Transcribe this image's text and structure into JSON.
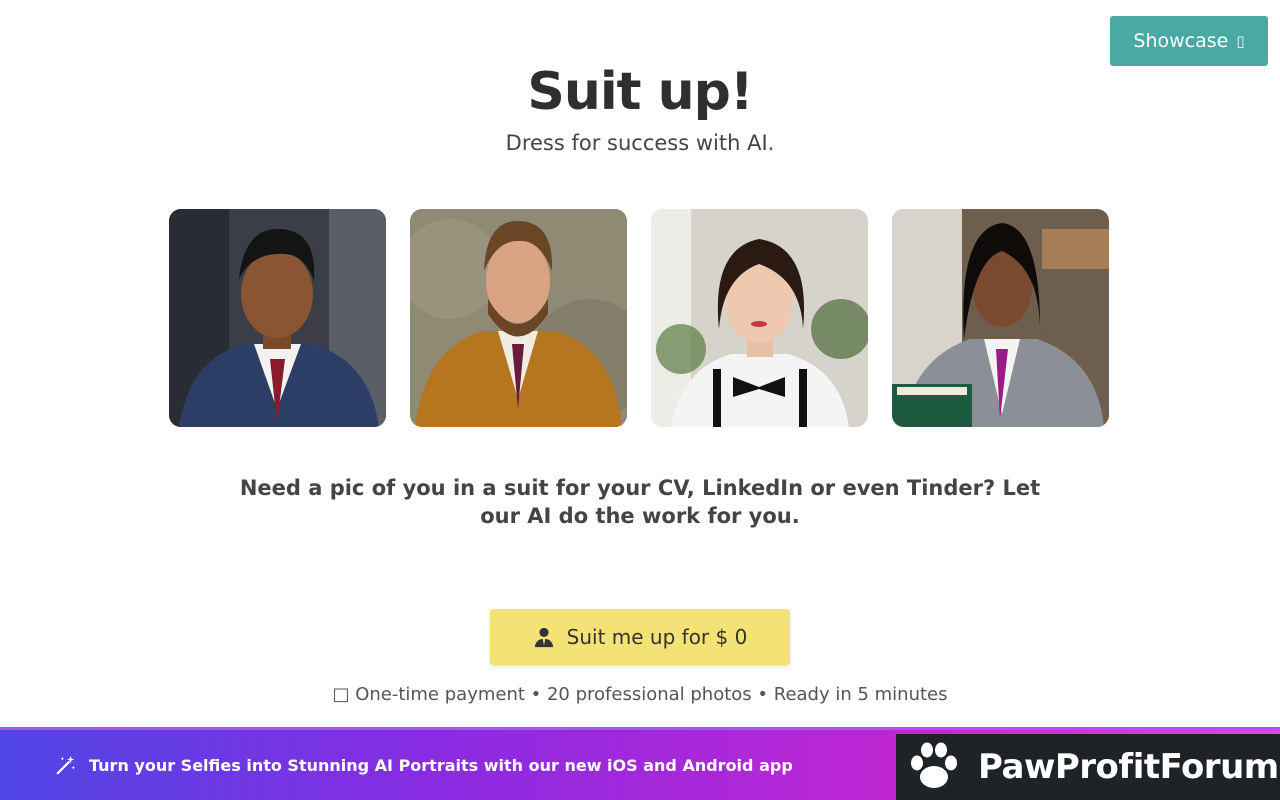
{
  "header": {
    "showcase_label": "Showcase",
    "showcase_icon": "external-link-icon"
  },
  "hero": {
    "title": "Suit up!",
    "subtitle": "Dress for success with AI."
  },
  "gallery": {
    "photos": [
      {
        "label": "man-navy-suit",
        "bg": "#4a4a52",
        "suit": "#2c3e66",
        "tie": "#8b1a2b"
      },
      {
        "label": "bearded-man-mustard-suit",
        "bg": "#8a8672",
        "suit": "#b5761f",
        "tie": "#6a1a3a"
      },
      {
        "label": "woman-bowtie",
        "bg": "#d8d5cf",
        "suit": "#f2f2f2",
        "tie": "#111111"
      },
      {
        "label": "woman-grey-blazer",
        "bg": "#7a6a5a",
        "suit": "#8d8f96",
        "tie": "#9b1a8a"
      }
    ]
  },
  "pitch": {
    "text": "Need a pic of you in a suit for your CV, LinkedIn or even Tinder? Let our AI do the work for you."
  },
  "cta": {
    "label": "Suit me up for $ 0",
    "icon": "person-suit-icon",
    "color": "#f5e276"
  },
  "meta": {
    "text": "□ One-time payment • 20 professional photos • Ready in 5 minutes"
  },
  "banner": {
    "text": "Turn your Selfies into Stunning AI Portraits with our new iOS and Android app",
    "icon": "magic-wand-icon"
  },
  "brand": {
    "name": "PawProfitForum",
    "icon": "paw-icon"
  },
  "colors": {
    "accent": "#4aa9a3",
    "cta": "#f5e276"
  }
}
